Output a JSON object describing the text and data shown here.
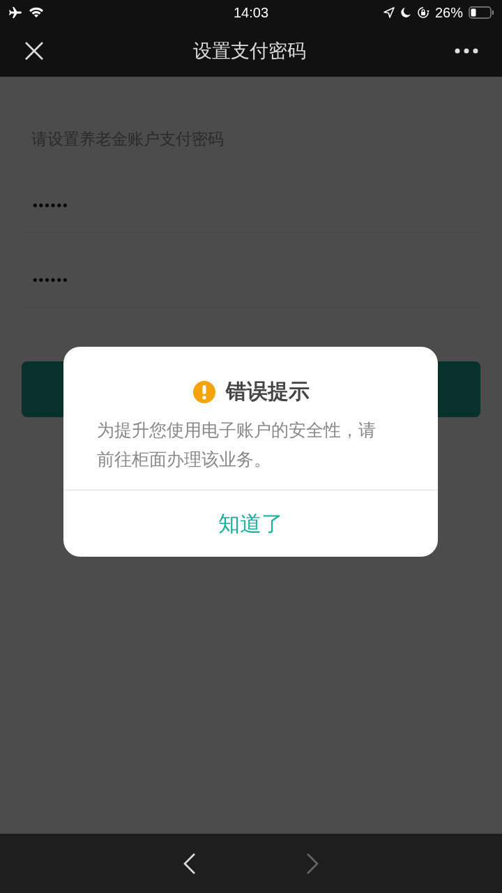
{
  "status_bar": {
    "time": "14:03",
    "battery_text": "26%"
  },
  "nav_bar": {
    "title": "设置支付密码"
  },
  "form": {
    "instruction": "请设置养老金账户支付密码",
    "fields": [
      {
        "value": "••••••"
      },
      {
        "value": "••••••"
      }
    ]
  },
  "dialog": {
    "title": "错误提示",
    "message": "为提升您使用电子账户的安全性，请前往柜面办理该业务。",
    "button": "知道了"
  },
  "browser_nav": {
    "back": {
      "disabled": false
    },
    "forward": {
      "disabled": true
    }
  }
}
